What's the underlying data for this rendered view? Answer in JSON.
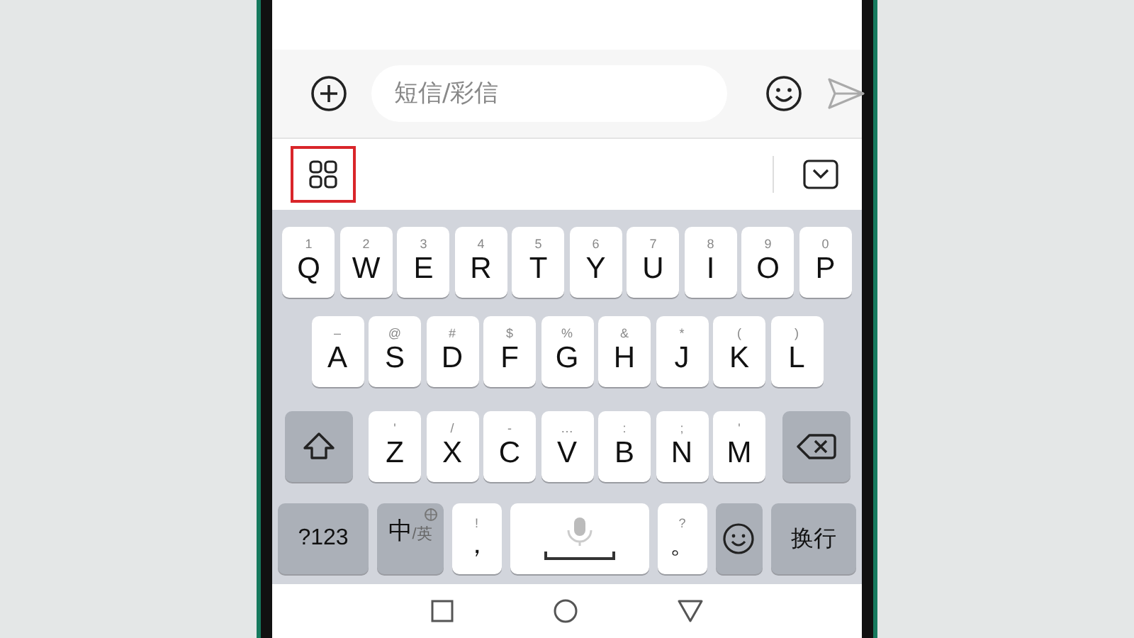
{
  "message_bar": {
    "placeholder": "短信/彩信"
  },
  "toolbar": {
    "apps_button": {
      "highlighted": true
    }
  },
  "keyboard": {
    "rows": [
      {
        "keys": [
          {
            "kind": "letter",
            "hint": "1",
            "label": "Q"
          },
          {
            "kind": "letter",
            "hint": "2",
            "label": "W"
          },
          {
            "kind": "letter",
            "hint": "3",
            "label": "E"
          },
          {
            "kind": "letter",
            "hint": "4",
            "label": "R"
          },
          {
            "kind": "letter",
            "hint": "5",
            "label": "T"
          },
          {
            "kind": "letter",
            "hint": "6",
            "label": "Y"
          },
          {
            "kind": "letter",
            "hint": "7",
            "label": "U"
          },
          {
            "kind": "letter",
            "hint": "8",
            "label": "I"
          },
          {
            "kind": "letter",
            "hint": "9",
            "label": "O"
          },
          {
            "kind": "letter",
            "hint": "0",
            "label": "P"
          }
        ]
      },
      {
        "keys": [
          {
            "kind": "letter",
            "hint": "–",
            "label": "A"
          },
          {
            "kind": "letter",
            "hint": "@",
            "label": "S"
          },
          {
            "kind": "letter",
            "hint": "#",
            "label": "D"
          },
          {
            "kind": "letter",
            "hint": "$",
            "label": "F"
          },
          {
            "kind": "letter",
            "hint": "%",
            "label": "G"
          },
          {
            "kind": "letter",
            "hint": "&",
            "label": "H"
          },
          {
            "kind": "letter",
            "hint": "*",
            "label": "J"
          },
          {
            "kind": "letter",
            "hint": "(",
            "label": "K"
          },
          {
            "kind": "letter",
            "hint": ")",
            "label": "L"
          }
        ]
      },
      {
        "keys": [
          {
            "kind": "shift"
          },
          {
            "kind": "letter",
            "hint": "'",
            "label": "Z"
          },
          {
            "kind": "letter",
            "hint": "/",
            "label": "X"
          },
          {
            "kind": "letter",
            "hint": "-",
            "label": "C"
          },
          {
            "kind": "letter",
            "hint": "…",
            "label": "V"
          },
          {
            "kind": "letter",
            "hint": ":",
            "label": "B"
          },
          {
            "kind": "letter",
            "hint": ";",
            "label": "N"
          },
          {
            "kind": "letter",
            "hint": "'",
            "label": "M"
          },
          {
            "kind": "backspace"
          }
        ]
      },
      {
        "keys": [
          {
            "kind": "function",
            "label": "?123"
          },
          {
            "kind": "lang",
            "label": "中",
            "sub": "/英"
          },
          {
            "kind": "punct",
            "hint": "!",
            "label": "，"
          },
          {
            "kind": "space"
          },
          {
            "kind": "punct",
            "hint": "?",
            "label": "。"
          },
          {
            "kind": "emoji"
          },
          {
            "kind": "function",
            "label": "换行"
          }
        ]
      }
    ]
  }
}
